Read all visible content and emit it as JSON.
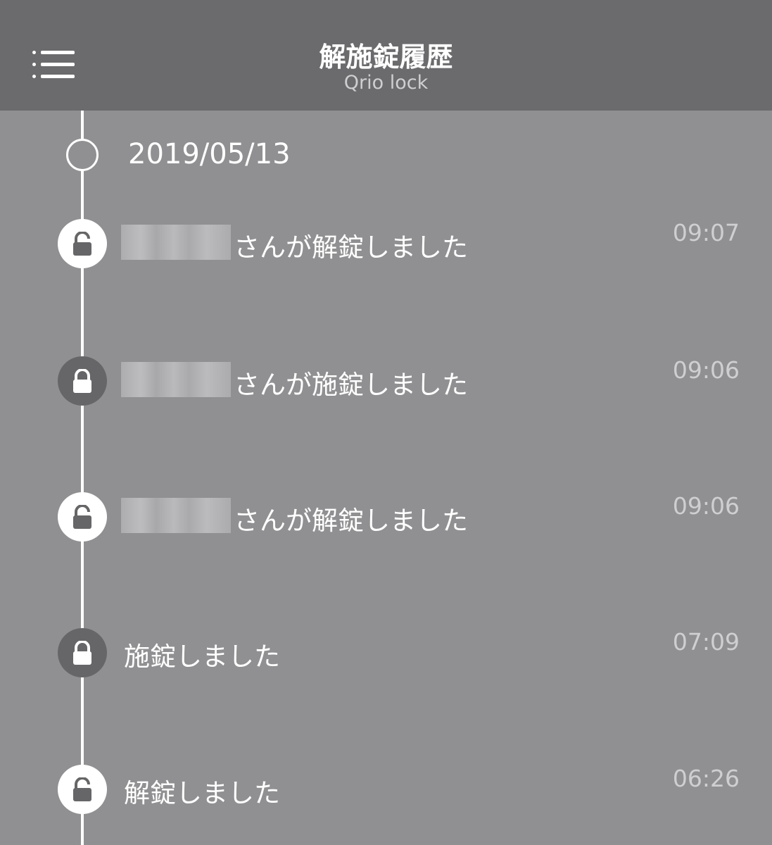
{
  "header": {
    "title": "解施錠履歴",
    "subtitle": "Qrio lock"
  },
  "timeline": {
    "date": "2019/05/13",
    "entries": [
      {
        "type": "unlock",
        "name_blurred": true,
        "text": "さんが解錠しました",
        "time": "09:07"
      },
      {
        "type": "lock",
        "name_blurred": true,
        "text": "さんが施錠しました",
        "time": "09:06"
      },
      {
        "type": "unlock",
        "name_blurred": true,
        "text": "さんが解錠しました",
        "time": "09:06"
      },
      {
        "type": "lock",
        "name_blurred": false,
        "text": "施錠しました",
        "time": "07:09"
      },
      {
        "type": "unlock",
        "name_blurred": false,
        "text": "解錠しました",
        "time": "06:26"
      }
    ]
  },
  "colors": {
    "header_bg": "#6b6b6d",
    "content_bg": "#909092",
    "unlock_icon_bg": "#ffffff",
    "lock_icon_bg": "#666668",
    "time_text": "#cfcfd1"
  },
  "icons": {
    "menu": "menu-icon",
    "unlocked": "unlocked-padlock-icon",
    "locked": "locked-padlock-icon"
  }
}
